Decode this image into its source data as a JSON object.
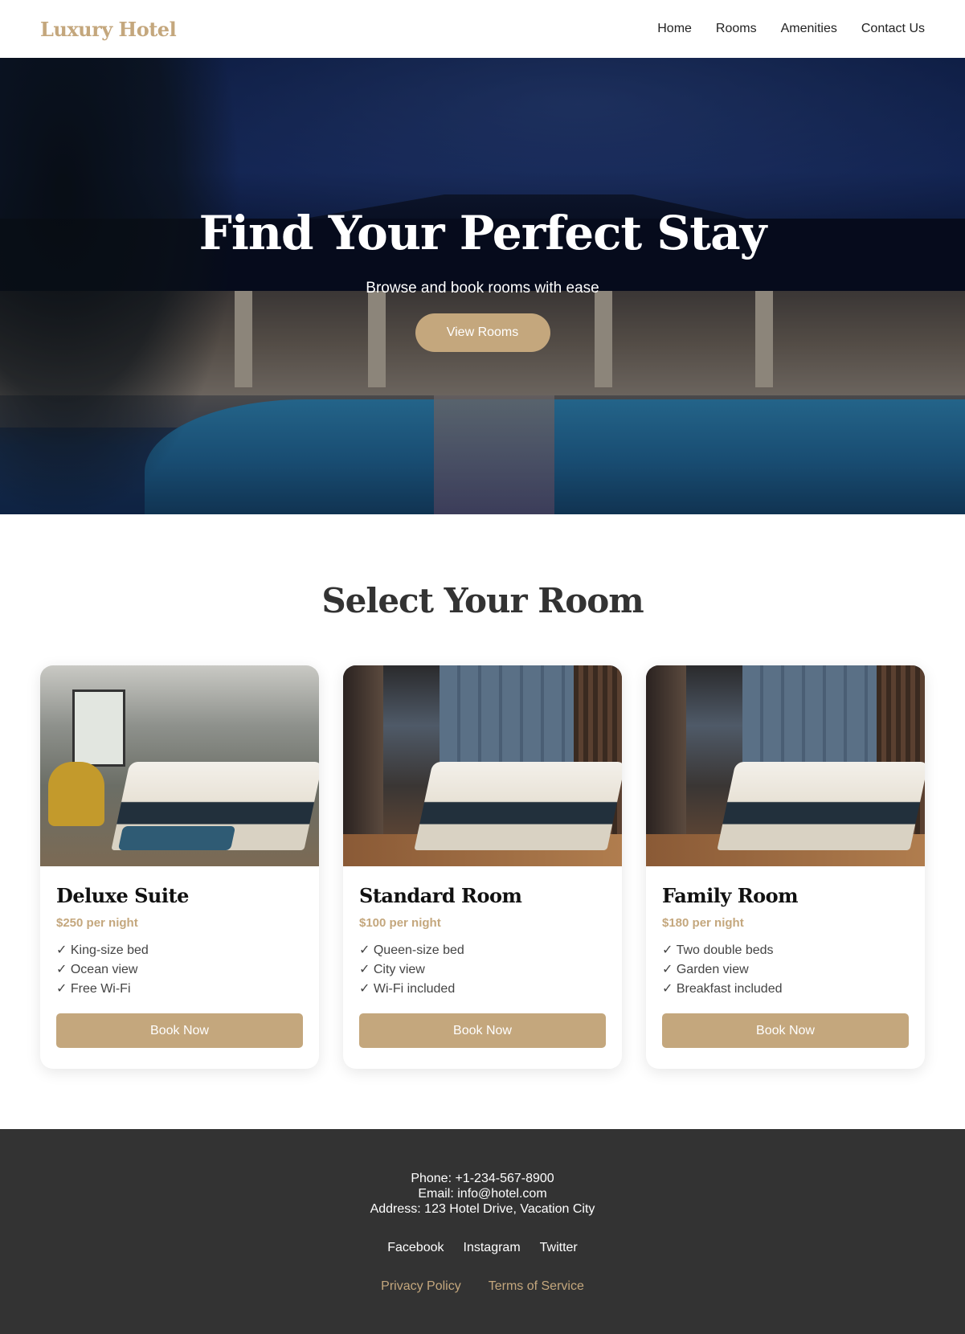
{
  "header": {
    "logo": "Luxury Hotel",
    "nav": [
      "Home",
      "Rooms",
      "Amenities",
      "Contact Us"
    ]
  },
  "hero": {
    "title": "Find Your Perfect Stay",
    "subtitle": "Browse and book rooms with ease",
    "button": "View Rooms"
  },
  "rooms": {
    "title": "Select Your Room",
    "cards": [
      {
        "name": "Deluxe Suite",
        "price": "$250 per night",
        "features": [
          "✓ King-size bed",
          "✓ Ocean view",
          "✓ Free Wi-Fi"
        ],
        "button": "Book Now"
      },
      {
        "name": "Standard Room",
        "price": "$100 per night",
        "features": [
          "✓ Queen-size bed",
          "✓ City view",
          "✓ Wi-Fi included"
        ],
        "button": "Book Now"
      },
      {
        "name": "Family Room",
        "price": "$180 per night",
        "features": [
          "✓ Two double beds",
          "✓ Garden view",
          "✓ Breakfast included"
        ],
        "button": "Book Now"
      }
    ]
  },
  "footer": {
    "phone": "Phone: +1-234-567-8900",
    "email": "Email: info@hotel.com",
    "address": "Address: 123 Hotel Drive, Vacation City",
    "social": [
      "Facebook",
      "Instagram",
      "Twitter"
    ],
    "legal": [
      "Privacy Policy",
      "Terms of Service"
    ]
  },
  "colors": {
    "accent": "#c4a77d",
    "footer_bg": "#333333"
  }
}
